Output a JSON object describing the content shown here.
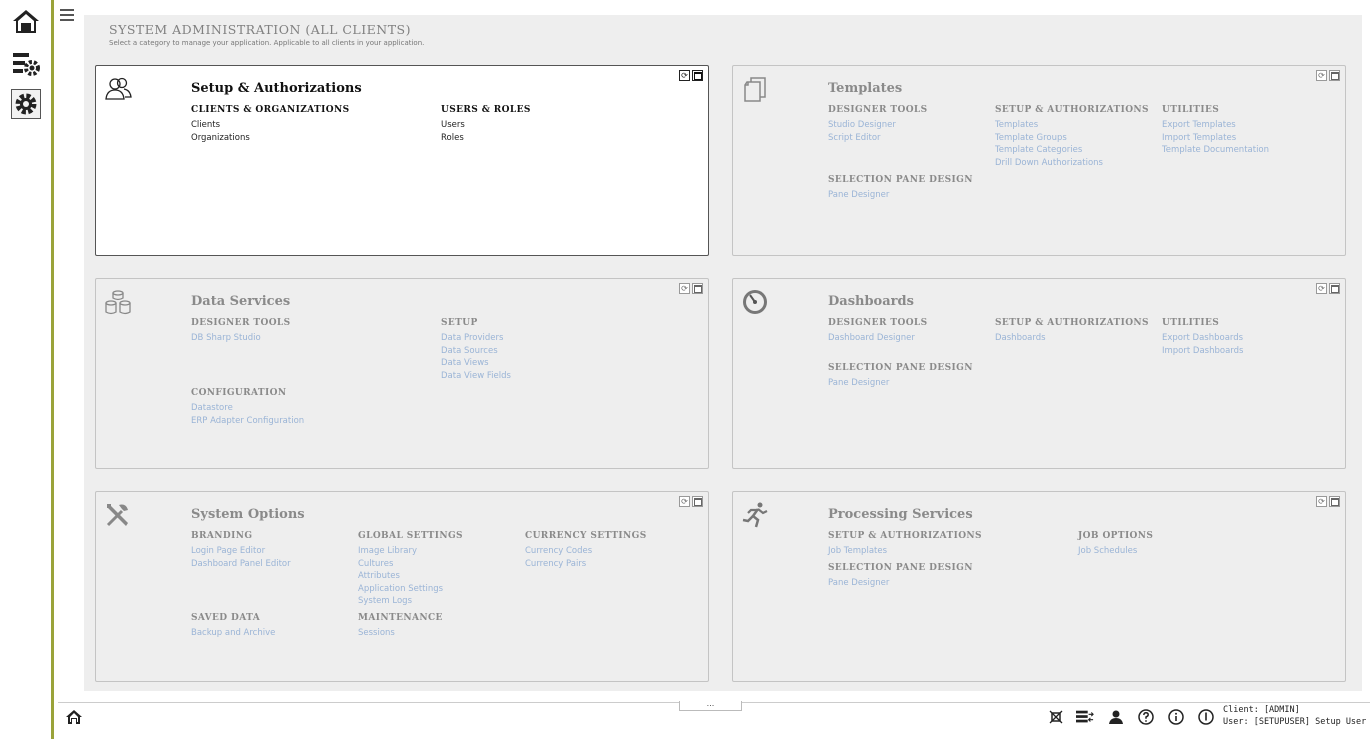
{
  "colors": {
    "accent": "#9aa33a",
    "link": "#9ab4d6",
    "muted": "#8a8a8a"
  },
  "rail": {
    "items": [
      {
        "name": "home",
        "icon": "home-icon"
      },
      {
        "name": "scheduling",
        "icon": "settings-list-icon"
      },
      {
        "name": "administration",
        "icon": "gear-icon"
      }
    ]
  },
  "page": {
    "title": "SYSTEM ADMINISTRATION (ALL CLIENTS)",
    "subtitle": "Select a category to manage your application. Applicable to all clients in your application."
  },
  "panels": {
    "setup": {
      "title": "Setup & Authorizations",
      "icon": "users-icon",
      "groups": [
        {
          "title": "CLIENTS & ORGANIZATIONS",
          "links": [
            "Clients",
            "Organizations"
          ]
        },
        {
          "title": "USERS & ROLES",
          "links": [
            "Users",
            "Roles"
          ]
        }
      ]
    },
    "templates": {
      "title": "Templates",
      "icon": "documents-icon",
      "groups": [
        {
          "title": "DESIGNER TOOLS",
          "links": [
            "Studio Designer",
            "Script Editor"
          ]
        },
        {
          "title": "SETUP & AUTHORIZATIONS",
          "links": [
            "Templates",
            "Template Groups",
            "Template Categories",
            "Drill Down Authorizations"
          ]
        },
        {
          "title": "UTILITIES",
          "links": [
            "Export Templates",
            "Import Templates",
            "Template Documentation"
          ]
        },
        {
          "title": "SELECTION PANE DESIGN",
          "links": [
            "Pane Designer"
          ]
        }
      ]
    },
    "data": {
      "title": "Data Services",
      "icon": "database-icon",
      "groups": [
        {
          "title": "DESIGNER TOOLS",
          "links": [
            "DB Sharp Studio"
          ]
        },
        {
          "title": "SETUP",
          "links": [
            "Data Providers",
            "Data Sources",
            "Data Views",
            "Data View Fields"
          ]
        },
        {
          "title": "CONFIGURATION",
          "links": [
            "Datastore",
            "ERP Adapter Configuration"
          ]
        }
      ]
    },
    "dashboards": {
      "title": "Dashboards",
      "icon": "gauge-icon",
      "groups": [
        {
          "title": "DESIGNER TOOLS",
          "links": [
            "Dashboard Designer"
          ]
        },
        {
          "title": "SETUP & AUTHORIZATIONS",
          "links": [
            "Dashboards"
          ]
        },
        {
          "title": "UTILITIES",
          "links": [
            "Export Dashboards",
            "Import Dashboards"
          ]
        },
        {
          "title": "SELECTION PANE DESIGN",
          "links": [
            "Pane Designer"
          ]
        }
      ]
    },
    "system": {
      "title": "System Options",
      "icon": "tools-icon",
      "groups": [
        {
          "title": "BRANDING",
          "links": [
            "Login Page Editor",
            "Dashboard Panel Editor"
          ]
        },
        {
          "title": "GLOBAL SETTINGS",
          "links": [
            "Image Library",
            "Cultures",
            "Attributes",
            "Application Settings",
            "System Logs"
          ]
        },
        {
          "title": "CURRENCY SETTINGS",
          "links": [
            "Currency Codes",
            "Currency Pairs"
          ]
        },
        {
          "title": "SAVED DATA",
          "links": [
            "Backup and Archive"
          ]
        },
        {
          "title": "MAINTENANCE",
          "links": [
            "Sessions"
          ]
        }
      ]
    },
    "processing": {
      "title": "Processing Services",
      "icon": "running-icon",
      "groups": [
        {
          "title": "SETUP & AUTHORIZATIONS",
          "links": [
            "Job Templates"
          ]
        },
        {
          "title": "JOB OPTIONS",
          "links": [
            "Job Schedules"
          ]
        },
        {
          "title": "SELECTION PANE DESIGN",
          "links": [
            "Pane Designer"
          ]
        }
      ]
    }
  },
  "bottom": {
    "more_label": "...",
    "client": "Client: [ADMIN]",
    "user": "User: [SETUPUSER] Setup User"
  }
}
